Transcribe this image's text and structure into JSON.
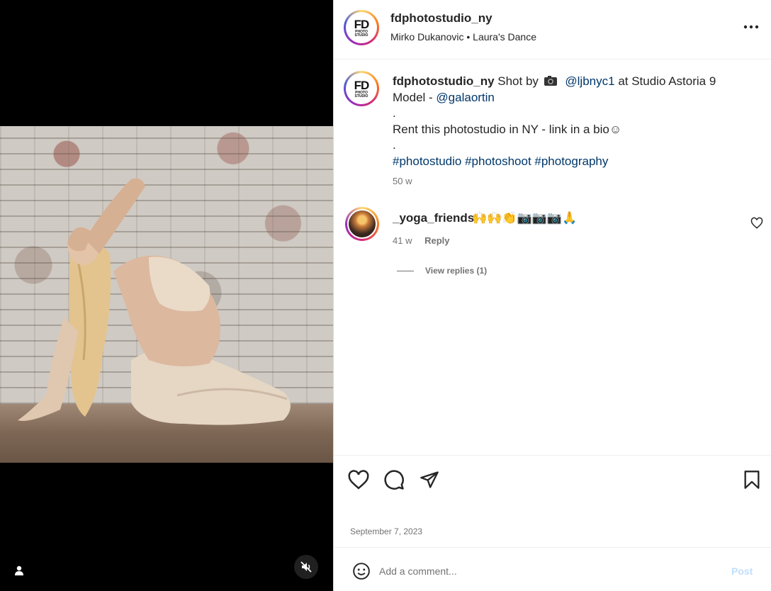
{
  "header": {
    "username": "fdphotostudio_ny",
    "subline": "Mirko Dukanovic • Laura's Dance",
    "avatar_logo": {
      "big": "FD",
      "line1": "PHOTO",
      "line2": "STUDIO"
    }
  },
  "caption": {
    "username": "fdphotostudio_ny",
    "text_shot_by": "Shot by",
    "mention_1": "@ljbnyc1",
    "text_at": "at Studio Astoria 9",
    "text_model": "Model -",
    "mention_2": "@galaortin",
    "dot_1": ".",
    "rent_line": "Rent this photostudio in NY - link in a bio☺",
    "dot_2": ".",
    "hashtags": "#photostudio #photoshoot #photography",
    "time": "50 w"
  },
  "comment": {
    "username": "_yoga_friends",
    "emojis": "🙌🙌👏📷📷📷🙏",
    "time": "41 w",
    "reply_label": "Reply",
    "view_replies": "View replies (1)"
  },
  "post_date": "September  7, 2023",
  "add_comment": {
    "placeholder": "Add a comment...",
    "post_label": "Post"
  },
  "icons": {
    "more": "more-horizontal-icon",
    "like": "heart-icon",
    "comment": "comment-bubble-icon",
    "share": "paper-plane-icon",
    "save": "bookmark-icon",
    "emoji": "smiley-icon",
    "user_tags": "user-icon",
    "mute": "speaker-muted-icon"
  },
  "colors": {
    "link": "#00376b",
    "muted_text": "#737373",
    "post_disabled": "#c0dffd"
  }
}
